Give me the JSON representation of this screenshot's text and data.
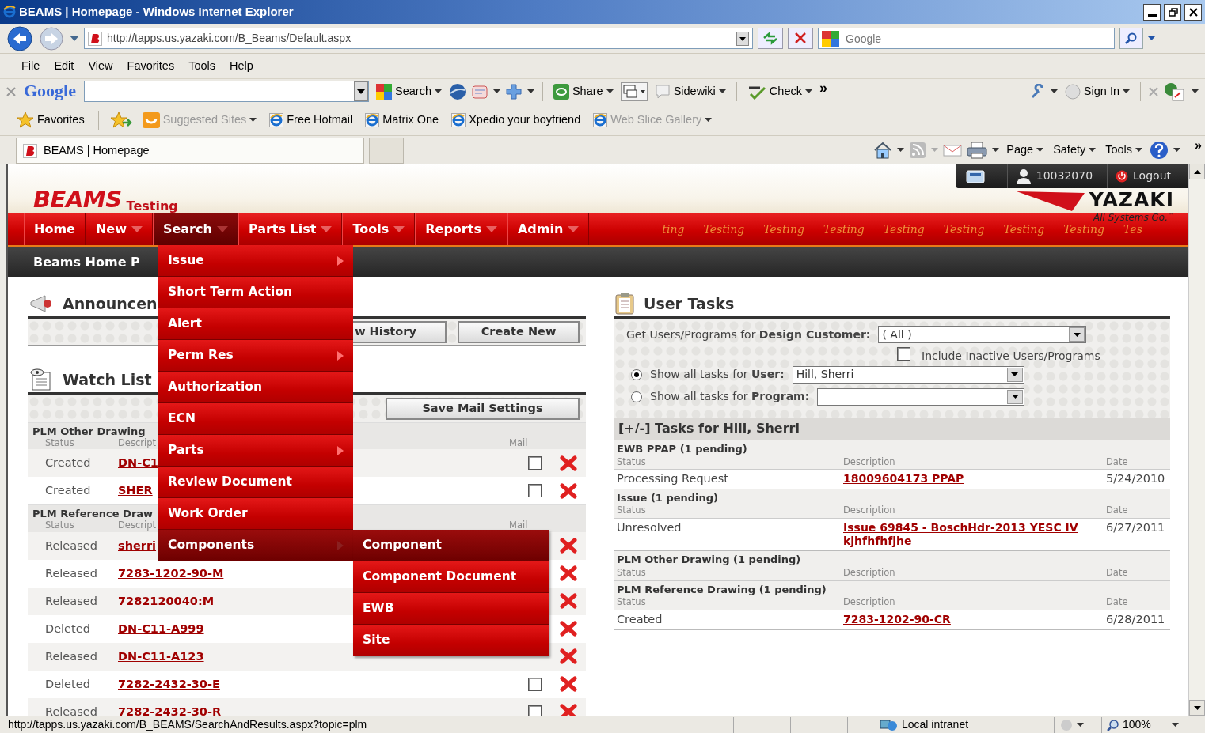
{
  "window": {
    "title": "BEAMS | Homepage - Windows Internet Explorer"
  },
  "address_bar": {
    "url": "http://tapps.us.yazaki.com/B_Beams/Default.aspx"
  },
  "search_box": {
    "placeholder": "Google"
  },
  "menu_bar": [
    "File",
    "Edit",
    "View",
    "Favorites",
    "Tools",
    "Help"
  ],
  "google_toolbar": {
    "logo": "Google",
    "labels": [
      "Search",
      "Share",
      "Sidewiki",
      "Check",
      "»",
      "Sign In"
    ]
  },
  "favorites_bar": {
    "favorites": "Favorites",
    "links": [
      {
        "label": "Suggested Sites",
        "disabled": true,
        "dropdown": true
      },
      {
        "label": "Free Hotmail",
        "disabled": false,
        "dropdown": false
      },
      {
        "label": "Matrix One",
        "disabled": false,
        "dropdown": false
      },
      {
        "label": "Xpedio your boyfriend",
        "disabled": false,
        "dropdown": false
      },
      {
        "label": "Web Slice Gallery",
        "disabled": true,
        "dropdown": true
      }
    ]
  },
  "tab": {
    "title": "BEAMS | Homepage",
    "selected": true
  },
  "command_bar": [
    "Page",
    "Safety",
    "Tools",
    "»"
  ],
  "header": {
    "logo": "BEAMS",
    "environment": "Testing",
    "user_id": "10032070",
    "logout": "Logout",
    "brand": "YAZAKI",
    "tagline": "All Systems Go.",
    "tm": "™"
  },
  "nav": [
    {
      "label": "Home",
      "dropdown": false,
      "selected": false
    },
    {
      "label": "New",
      "dropdown": true,
      "selected": false
    },
    {
      "label": "Search",
      "dropdown": true,
      "selected": true
    },
    {
      "label": "Parts List",
      "dropdown": true,
      "selected": false
    },
    {
      "label": "Tools",
      "dropdown": true,
      "selected": false
    },
    {
      "label": "Reports",
      "dropdown": true,
      "selected": false
    },
    {
      "label": "Admin",
      "dropdown": true,
      "selected": false
    }
  ],
  "nav_watermark": [
    "ting",
    "Testing",
    "Testing",
    "Testing",
    "Testing",
    "Testing",
    "Testing",
    "Testing",
    "Tes"
  ],
  "page_title": "Beams Home P",
  "search_menu": [
    {
      "label": "Issue",
      "submenu": true,
      "expanded": false
    },
    {
      "label": "Short Term Action",
      "submenu": false,
      "expanded": false
    },
    {
      "label": "Alert",
      "submenu": false,
      "expanded": false
    },
    {
      "label": "Perm Res",
      "submenu": true,
      "expanded": false
    },
    {
      "label": "Authorization",
      "submenu": false,
      "expanded": false
    },
    {
      "label": "ECN",
      "submenu": false,
      "expanded": false
    },
    {
      "label": "Parts",
      "submenu": true,
      "expanded": false
    },
    {
      "label": "Review Document",
      "submenu": false,
      "expanded": false
    },
    {
      "label": "Work Order",
      "submenu": false,
      "expanded": false
    },
    {
      "label": "Components",
      "submenu": true,
      "expanded": true
    }
  ],
  "components_submenu": [
    {
      "label": "Component",
      "selected": true
    },
    {
      "label": "Component Document",
      "selected": false
    },
    {
      "label": "EWB",
      "selected": false
    },
    {
      "label": "Site",
      "selected": false
    }
  ],
  "announcements": {
    "title": "Announcen",
    "buttons": [
      "w History",
      "Create New"
    ]
  },
  "watch_list": {
    "title": "Watch List",
    "save_button": "Save Mail Settings",
    "groups": [
      {
        "name": "PLM Other Drawing",
        "columns": [
          "Status",
          "Descript",
          "Mail"
        ],
        "rows": [
          {
            "status": "Created",
            "description": "DN-C1",
            "mail_checked": false
          },
          {
            "status": "Created",
            "description": "SHER",
            "mail_checked": false
          }
        ]
      },
      {
        "name": "PLM Reference Draw",
        "columns": [
          "Status",
          "Descript",
          "Mail"
        ],
        "rows": [
          {
            "status": "Released",
            "description": "sherri"
          },
          {
            "status": "Released",
            "description": "7283-1202-90-M"
          },
          {
            "status": "Released",
            "description": "7282120040:M"
          },
          {
            "status": "Deleted",
            "description": "DN-C11-A999"
          },
          {
            "status": "Released",
            "description": "DN-C11-A123"
          },
          {
            "status": "Deleted",
            "description": "7282-2432-30-E",
            "mail_checked": false
          },
          {
            "status": "Released",
            "description": "7282-2432-30-R",
            "mail_checked": false
          }
        ]
      }
    ]
  },
  "user_tasks": {
    "title": "User Tasks",
    "customer_label": "Get Users/Programs for **Design Customer:**",
    "customer_value": "( All )",
    "include_inactive": {
      "label": "Include Inactive Users/Programs",
      "checked": false
    },
    "options": [
      {
        "label": "Show all tasks for **User:**",
        "selected": true,
        "value": "Hill, Sherri"
      },
      {
        "label": "Show all tasks for **Program:**",
        "selected": false
      }
    ],
    "tasks_header": "[+/-] Tasks for Hill, Sherri",
    "groups": [
      {
        "name": "EWB PPAP (1 pending)",
        "columns": [
          "Status",
          "Description",
          "Date"
        ],
        "rows": [
          {
            "status": "Processing Request",
            "description": "18009604173 PPAP",
            "date": "5/24/2010"
          }
        ]
      },
      {
        "name": "Issue (1 pending)",
        "columns": [
          "Status",
          "Description",
          "Date"
        ],
        "rows": [
          {
            "status": "Unresolved",
            "description": "Issue 69845 - BoschHdr-2013 YESC IV kjhfhfhfjhe",
            "date": "6/27/2011"
          }
        ]
      },
      {
        "name": "PLM Other Drawing (1 pending)",
        "columns": [
          "Status",
          "Description",
          "Date"
        ]
      },
      {
        "name": "PLM Reference Drawing (1 pending)",
        "columns": [
          "Status",
          "Description",
          "Date"
        ],
        "rows": [
          {
            "status": "Created",
            "description": "7283-1202-90-CR",
            "date": "6/28/2011"
          }
        ]
      }
    ]
  },
  "status_bar": {
    "url": "http://tapps.us.yazaki.com/B_BEAMS/SearchAndResults.aspx?topic=plm",
    "zone": "Local intranet",
    "zoom": "100%"
  }
}
